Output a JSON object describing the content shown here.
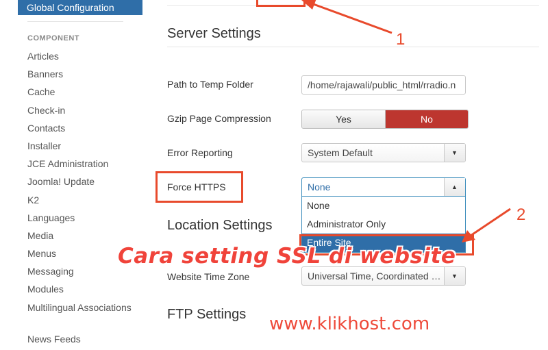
{
  "sidebar": {
    "active_item": "Global Configuration",
    "section_label": "COMPONENT",
    "items": [
      "Articles",
      "Banners",
      "Cache",
      "Check-in",
      "Contacts",
      "Installer",
      "JCE Administration",
      "Joomla! Update",
      "K2",
      "Languages",
      "Media",
      "Menus",
      "Messaging",
      "Modules",
      "Multilingual Associations",
      "News Feeds"
    ]
  },
  "server": {
    "heading": "Server Settings",
    "temp_label": "Path to Temp Folder",
    "temp_value": "/home/rajawali/public_html/rradio.n",
    "gzip_label": "Gzip Page Compression",
    "gzip_yes": "Yes",
    "gzip_no": "No",
    "error_label": "Error Reporting",
    "error_value": "System Default",
    "https_label": "Force HTTPS",
    "https_value": "None",
    "https_options": [
      "None",
      "Administrator Only",
      "Entire Site"
    ]
  },
  "location": {
    "heading": "Location Settings",
    "tz_label": "Website Time Zone",
    "tz_value": "Universal Time, Coordinated (UTC)"
  },
  "ftp": {
    "heading": "FTP Settings"
  },
  "annotations": {
    "num1": "1",
    "num2": "2",
    "overlay_title": "Cara setting SSL di website",
    "watermark": "www.klikhost.com",
    "accent_color": "#e84a2c"
  },
  "icons": {
    "caret_down": "▼",
    "caret_up": "▲"
  }
}
